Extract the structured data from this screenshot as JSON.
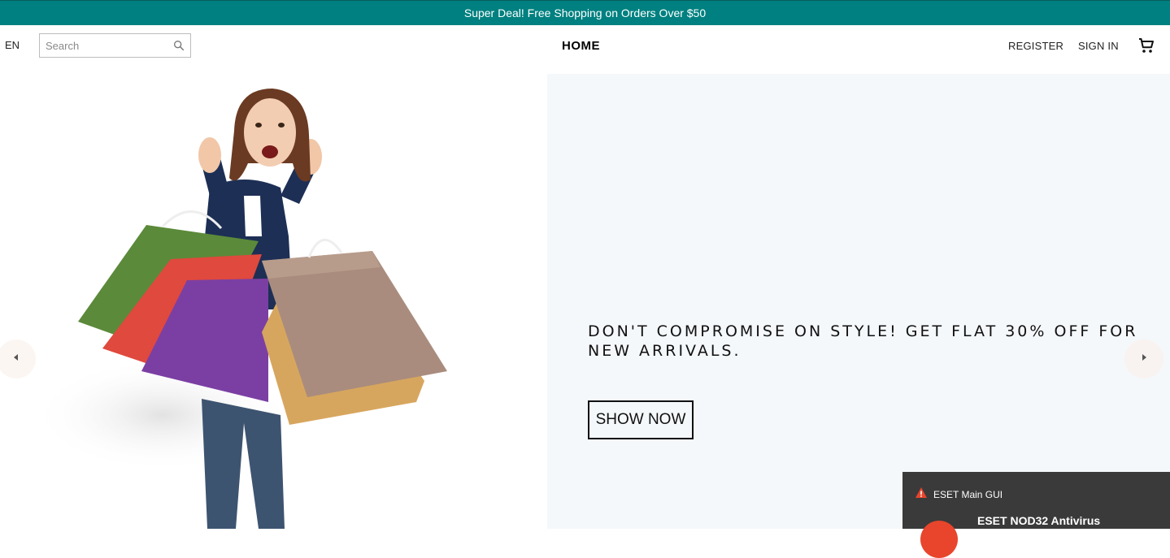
{
  "announcement": "Super Deal! Free Shopping on Orders Over $50",
  "header": {
    "language": "EN",
    "search_placeholder": "Search",
    "logo": "HOME",
    "register": "REGISTER",
    "sign_in": "SIGN IN"
  },
  "hero": {
    "headline": "DON'T COMPROMISE ON STYLE! GET FLAT 30% OFF FOR NEW ARRIVALS.",
    "cta": "SHOW NOW",
    "background_color": "#f4f8fb"
  },
  "notification": {
    "app": "ESET Main GUI",
    "title": "ESET NOD32 Antivirus"
  },
  "colors": {
    "announcement_bg": "#008080",
    "toast_bg": "#3a3a3a",
    "eset_red": "#e8452c"
  }
}
